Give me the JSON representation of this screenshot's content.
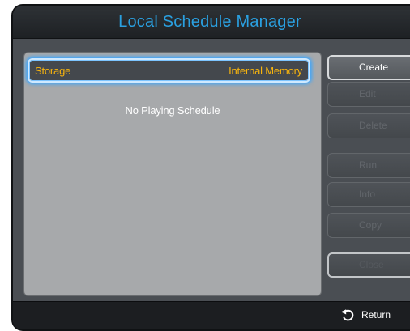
{
  "window": {
    "title": "Local Schedule Manager"
  },
  "list": {
    "storage_label": "Storage",
    "storage_value": "Internal Memory",
    "empty_message": "No Playing Schedule"
  },
  "buttons": {
    "create": "Create",
    "edit": "Edit",
    "delete": "Delete",
    "run": "Run",
    "info": "Info",
    "copy": "Copy",
    "close": "Close"
  },
  "footer": {
    "return_label": "Return",
    "return_icon": "return-icon"
  },
  "colors": {
    "title": "#2aa0e0",
    "highlight_text": "#f7b40e",
    "focus_glow": "#3aa6ff"
  }
}
